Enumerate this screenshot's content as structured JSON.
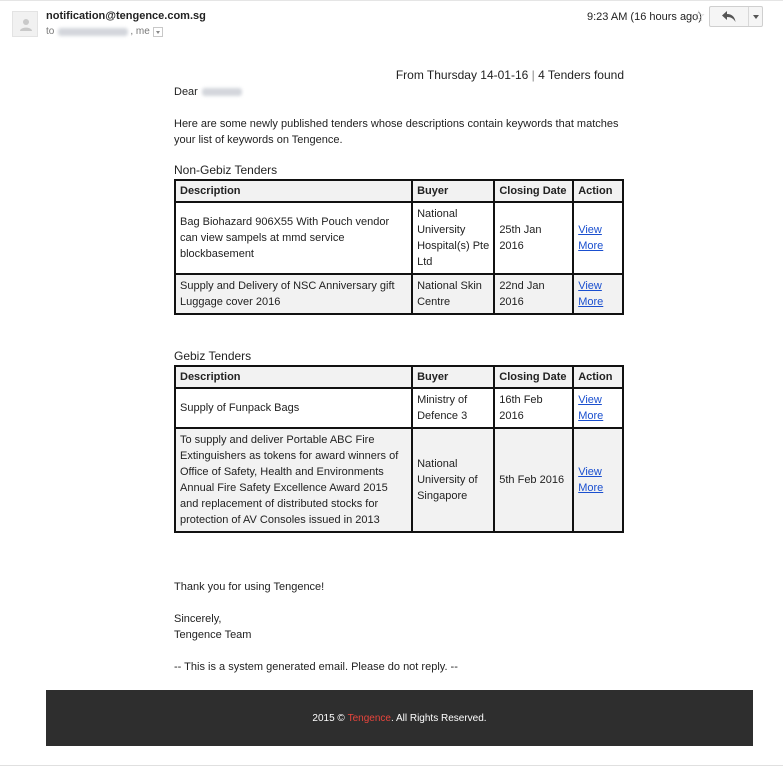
{
  "header": {
    "sender": "notification@tengence.com.sg",
    "to_prefix": "to",
    "to_suffix": ", me",
    "timestamp": "9:23 AM (16 hours ago)"
  },
  "icons": {
    "avatar": "person-avatar-icon",
    "star": "star-icon",
    "reply": "reply-arrow-icon",
    "more": "caret-down-icon",
    "details": "details-caret-icon"
  },
  "email": {
    "from_prefix": "From Thursday 14-01-16",
    "separator": "|",
    "tenders_found": "4 Tenders found",
    "greeting": "Dear",
    "intro": "Here are some newly published tenders whose descriptions contain keywords that matches your list of keywords on Tengence.",
    "thanks": "Thank you for using Tengence!",
    "sincerely": "Sincerely,",
    "team": "Tengence Team",
    "system_note": "-- This is a system generated email. Please do not reply. --"
  },
  "table_headers": {
    "description": "Description",
    "buyer": "Buyer",
    "closing_date": "Closing Date",
    "action": "Action"
  },
  "non_gebiz": {
    "title": "Non-Gebiz Tenders",
    "rows": [
      {
        "description": "Bag Biohazard 906X55 With Pouch vendor can view sampels at mmd service blockbasement",
        "buyer": "National University Hospital(s) Pte Ltd",
        "closing_date": "25th Jan 2016",
        "action_line1": "View",
        "action_line2": "More"
      },
      {
        "description": "Supply and Delivery of NSC Anniversary gift Luggage cover 2016",
        "buyer": "National Skin Centre",
        "closing_date": "22nd Jan 2016",
        "action_line1": "View",
        "action_line2": "More"
      }
    ]
  },
  "gebiz": {
    "title": "Gebiz Tenders",
    "rows": [
      {
        "description": "Supply of Funpack Bags",
        "buyer": "Ministry of Defence 3",
        "closing_date": "16th Feb 2016",
        "action_line1": "View",
        "action_line2": "More"
      },
      {
        "description": "To supply and deliver Portable ABC Fire Extinguishers as tokens for award winners of Office of Safety, Health and Environments Annual Fire Safety Excellence Award 2015 and replacement of distributed stocks for protection of AV Consoles issued in 2013",
        "buyer": "National University of Singapore",
        "closing_date": "5th Feb 2016",
        "action_line1": "View",
        "action_line2": "More"
      }
    ]
  },
  "footer": {
    "prefix": "2015 ©",
    "brand": "Tengence",
    "suffix": ". All Rights Reserved."
  },
  "colors": {
    "footer_bg": "#2e2e2e",
    "brand_red": "#e8453c",
    "link_blue": "#1a4fcf",
    "header_shade": "#f2f2f2"
  }
}
